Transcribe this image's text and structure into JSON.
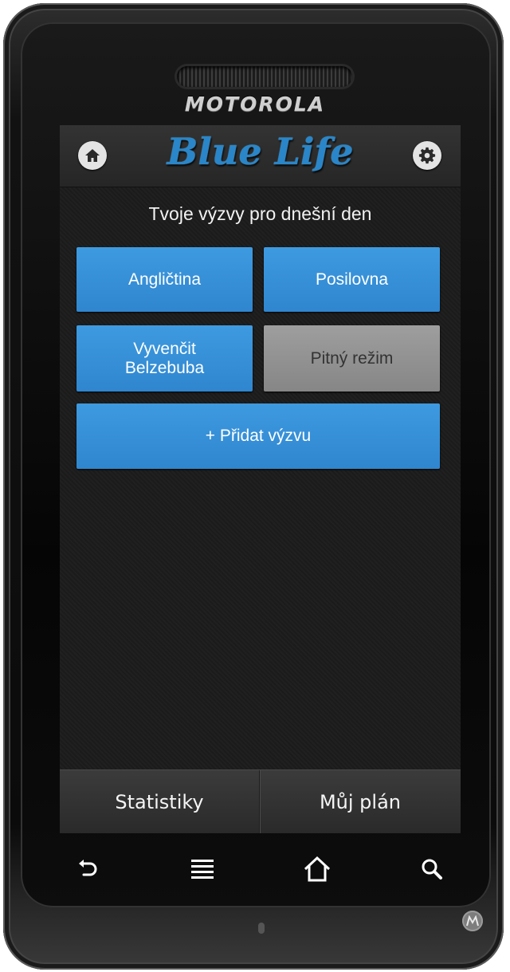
{
  "device": {
    "brand": "MOTOROLA"
  },
  "app": {
    "logo": "Blue Life",
    "subtitle": "Tvoje výzvy pro dnešní den"
  },
  "challenges": [
    {
      "label": "Angličtina",
      "state": "active"
    },
    {
      "label": "Posilovna",
      "state": "active"
    },
    {
      "label": "Vyvenčit Belzebuba",
      "state": "active"
    },
    {
      "label": "Pitný režim",
      "state": "inactive"
    }
  ],
  "add_challenge_label": "+ Přidat výzvu",
  "bottom_nav": {
    "statistics": "Statistiky",
    "my_plan": "Můj plán"
  },
  "icons": {
    "home": "home-icon",
    "settings": "gear-icon",
    "back": "back-icon",
    "menu": "menu-icon",
    "device_home": "home-outline-icon",
    "search": "search-icon"
  },
  "colors": {
    "accent_blue": "#3791d8",
    "inactive_gray": "#8f8f8f",
    "logo_blue": "#2a86c8"
  }
}
